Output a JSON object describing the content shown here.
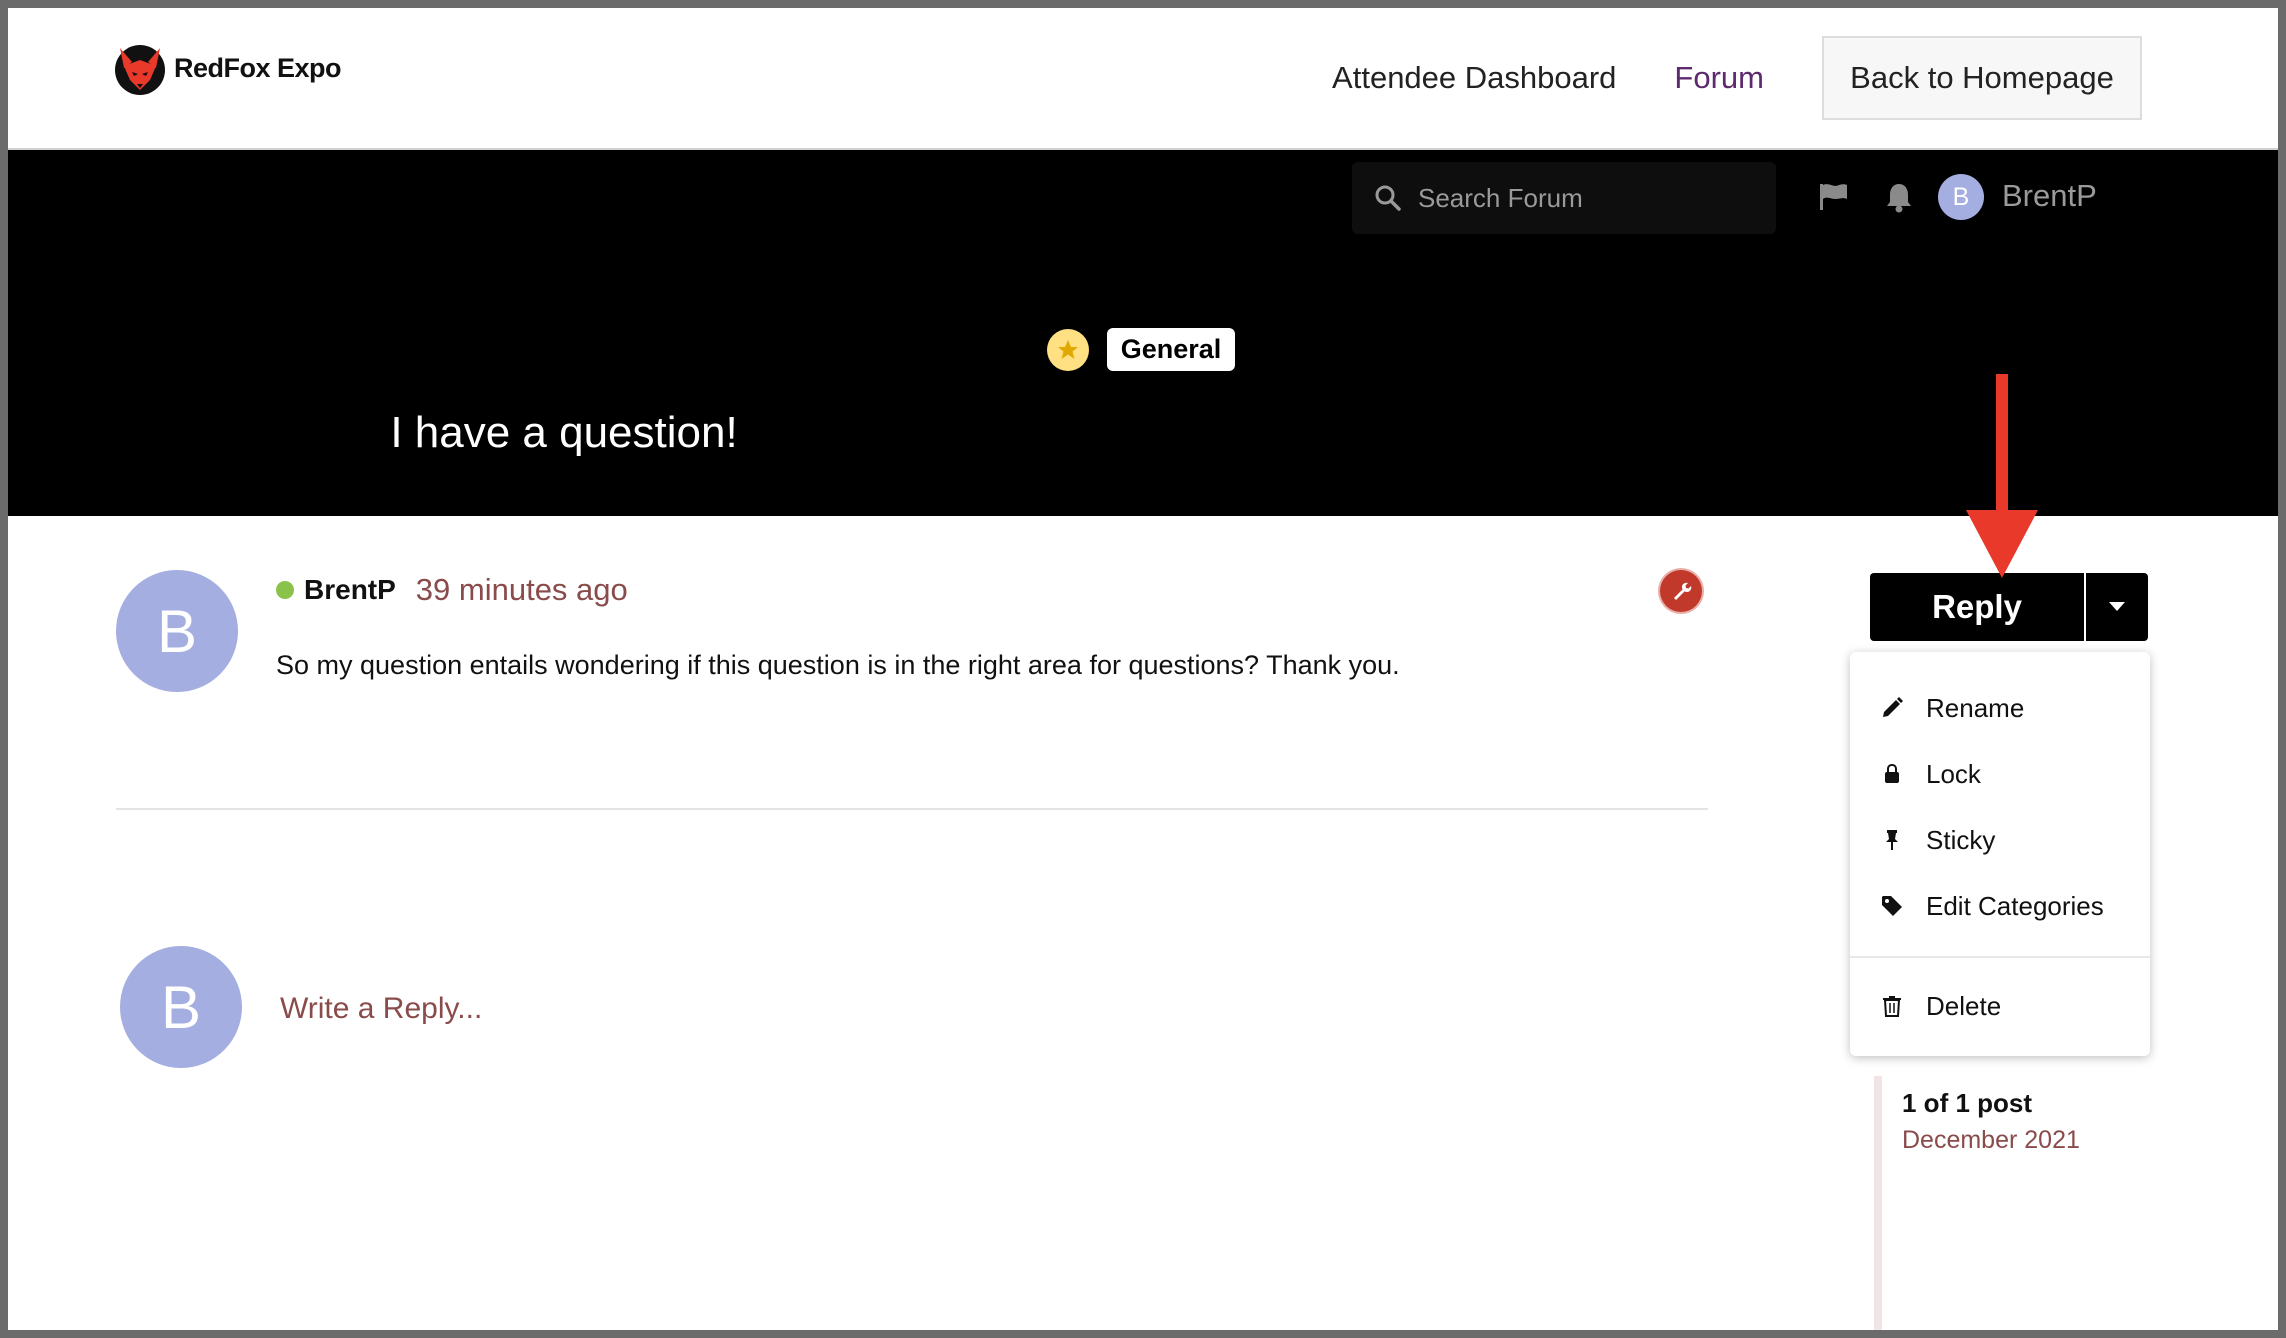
{
  "header": {
    "logo_text": "RedFox Expo",
    "nav": [
      {
        "label": "Attendee Dashboard",
        "active": false
      },
      {
        "label": "Forum",
        "active": true
      }
    ],
    "back_button": "Back to Homepage"
  },
  "forum_bar": {
    "search_placeholder": "Search Forum",
    "icons": [
      "flag-icon",
      "bell-icon"
    ],
    "user_initial": "B",
    "username": "BrentP"
  },
  "topic": {
    "category": "General",
    "title": "I have a question!"
  },
  "post": {
    "avatar_initial": "B",
    "username": "BrentP",
    "time": "39 minutes ago",
    "body": "So my question entails wondering if this question is in the right area for questions? Thank you."
  },
  "composer": {
    "avatar_initial": "B",
    "placeholder": "Write a Reply..."
  },
  "actions": {
    "reply_label": "Reply",
    "menu": [
      {
        "label": "Rename",
        "icon": "pencil-icon"
      },
      {
        "label": "Lock",
        "icon": "lock-icon"
      },
      {
        "label": "Sticky",
        "icon": "pin-icon"
      },
      {
        "label": "Edit Categories",
        "icon": "tag-icon"
      },
      {
        "label": "Delete",
        "icon": "trash-icon"
      }
    ]
  },
  "timeline": {
    "count": "1 of 1 post",
    "date": "December 2021"
  },
  "colors": {
    "accent_link": "#5d2a6e",
    "muted_text": "#8a4b4b",
    "avatar": "#a4aee0",
    "annotation_arrow": "#e8392b"
  }
}
